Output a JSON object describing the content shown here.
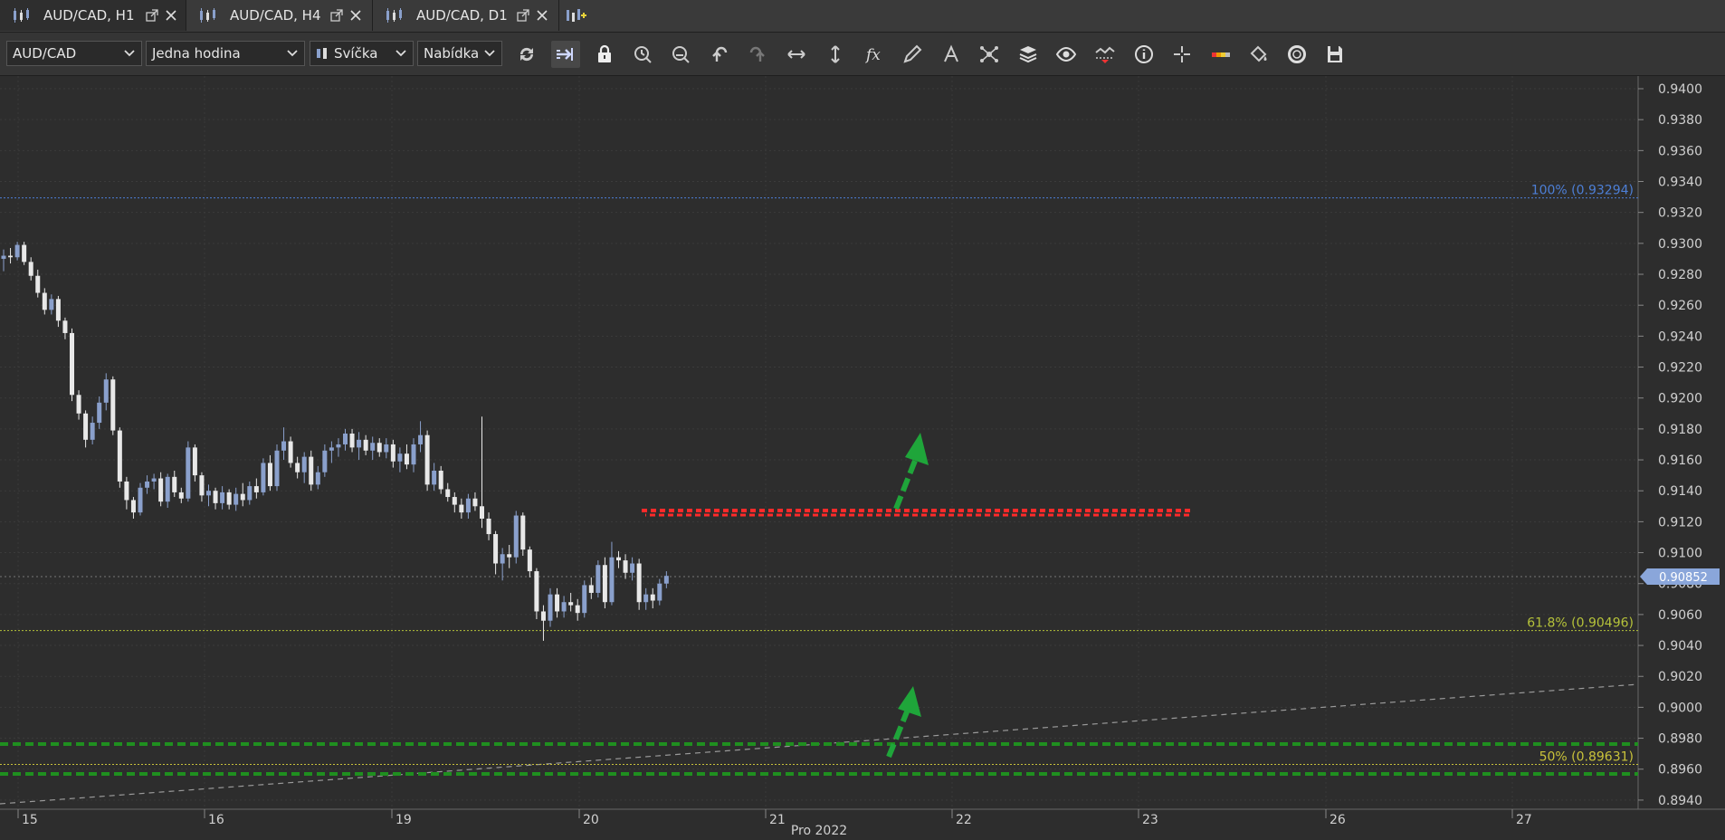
{
  "tabs": [
    {
      "label": "AUD/CAD, H1",
      "active": true
    },
    {
      "label": "AUD/CAD, H4",
      "active": false
    },
    {
      "label": "AUD/CAD, D1",
      "active": false
    }
  ],
  "toolbar": {
    "instrument": "AUD/CAD",
    "period": "Jedna hodina",
    "chart_type": "Svíčka",
    "price_side": "Nabídka"
  },
  "chart": {
    "price_ticks": [
      "0.9400",
      "0.9380",
      "0.9360",
      "0.9340",
      "0.9320",
      "0.9300",
      "0.9280",
      "0.9260",
      "0.9240",
      "0.9220",
      "0.9200",
      "0.9180",
      "0.9160",
      "0.9140",
      "0.9120",
      "0.9100",
      "0.9080",
      "0.9060",
      "0.9040",
      "0.9020",
      "0.9000",
      "0.8980",
      "0.8960",
      "0.8940"
    ],
    "day_labels": [
      "15",
      "16",
      "19",
      "20",
      "21",
      "22",
      "23",
      "26",
      "27"
    ],
    "month_label": "Pro 2022",
    "current_price": "0.90852",
    "fib_levels": [
      {
        "label": "100% (0.93294)",
        "price": 0.93294,
        "color": "#4d7fd6"
      },
      {
        "label": "61.8% (0.90496)",
        "price": 0.90496,
        "color": "#b5c23a"
      },
      {
        "label": "50% (0.89631)",
        "price": 0.89631,
        "color": "#c9c23a"
      }
    ],
    "colors": {
      "bull": "#8aa0cc",
      "bear": "#e8e8e8",
      "resistance": "#ff2a2a",
      "support": "#1f9c1f",
      "arrow": "#1fa53a"
    }
  }
}
